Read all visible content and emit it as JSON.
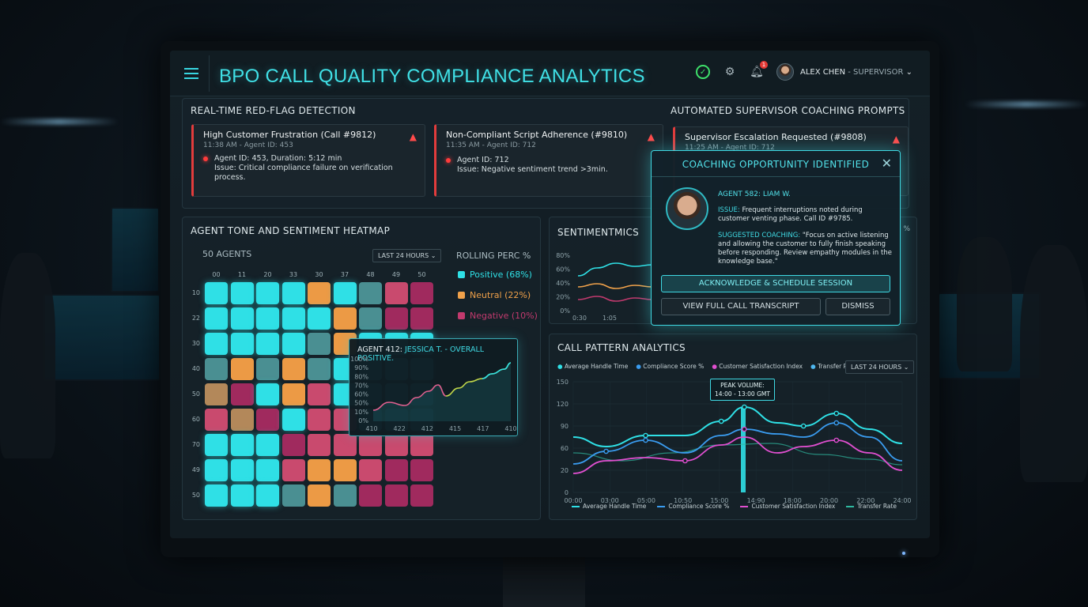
{
  "header": {
    "title": "BPO CALL QUALITY COMPLIANCE ANALYTICS",
    "notification_count": "1",
    "user_name": "ALEX CHEN",
    "user_role": " - SUPERVISOR"
  },
  "red_flags": {
    "title": "REAL-TIME RED-FLAG DETECTION",
    "alerts": [
      {
        "title": "High Customer Frustration (Call #9812)",
        "time": "11:38 AM - Agent ID: 453",
        "line1": "Agent ID: 453, Duration: 5:12 min",
        "line2": "Issue: Critical compliance failure on verification process."
      },
      {
        "title": "Non-Compliant Script Adherence (#9810)",
        "time": "11:35 AM - Agent ID: 712",
        "line1": "Agent ID: 712",
        "line2": "Issue: Negative sentiment trend >3min."
      }
    ]
  },
  "coaching": {
    "title": "AUTOMATED SUPERVISOR COACHING PROMPTS",
    "alert": {
      "title": "Supervisor Escalation Requested (#9808)",
      "time": "11:25 AM - Agent ID: 712"
    },
    "modal": {
      "title": "COACHING OPPORTUNITY IDENTIFIED",
      "agent": "AGENT 582: LIAM W.",
      "issue_label": "ISSUE:",
      "issue": "Frequent interruptions noted during customer venting phase. Call ID #9785.",
      "suggest_label": "SUGGESTED COACHING:",
      "suggest": "\"Focus on active listening and allowing the customer to fully finish speaking before responding. Review empathy modules in the knowledge base.\"",
      "btn_ack": "ACKNOWLEDGE & SCHEDULE SESSION",
      "btn_transcript": "VIEW FULL CALL TRANSCRIPT",
      "btn_dismiss": "DISMISS"
    }
  },
  "heatmap": {
    "title": "AGENT TONE AND SENTIMENT HEATMAP",
    "agents": "50 AGENTS",
    "range": "LAST 24 HOURS",
    "rolling_title": "ROLLING PERC %",
    "legend": [
      {
        "label": "Positive (68%)",
        "color": "#2fe0e6"
      },
      {
        "label": "Neutral (22%)",
        "color": "#f0a14a"
      },
      {
        "label": "Negative (10%)",
        "color": "#c23a6e"
      }
    ],
    "col_labels": [
      "00",
      "11",
      "20",
      "33",
      "30",
      "37",
      "48",
      "49",
      "50"
    ],
    "row_labels": [
      "10",
      "22",
      "30",
      "40",
      "50",
      "60",
      "70",
      "49",
      "50"
    ],
    "grid": [
      [
        "P",
        "P",
        "P",
        "P",
        "N",
        "P",
        "M",
        "R",
        "X"
      ],
      [
        "P",
        "P",
        "P",
        "P",
        "P",
        "N",
        "M",
        "X",
        "X"
      ],
      [
        "P",
        "P",
        "P",
        "P",
        "M",
        "N",
        "P",
        "P",
        "P"
      ],
      [
        "M",
        "N",
        "M",
        "N",
        "M",
        "P",
        "P",
        "P",
        "P"
      ],
      [
        "O",
        "X",
        "P",
        "N",
        "R",
        "P",
        "P",
        "P",
        "P"
      ],
      [
        "R",
        "O",
        "X",
        "P",
        "R",
        "R",
        "P",
        "P",
        "P"
      ],
      [
        "P",
        "P",
        "P",
        "X",
        "R",
        "R",
        "R",
        "R",
        "R"
      ],
      [
        "P",
        "P",
        "P",
        "R",
        "N",
        "N",
        "R",
        "X",
        "X"
      ],
      [
        "P",
        "P",
        "P",
        "M",
        "N",
        "M",
        "X",
        "X",
        "X"
      ]
    ],
    "colors": {
      "P": "#2fe0e6",
      "M": "#4a8f92",
      "N": "#ec9a45",
      "O": "#b3885a",
      "R": "#c94a6e",
      "X": "#a02a5e"
    },
    "tooltip": {
      "agent": "AGENT 412:",
      "rest": " JESSICA T. - OVERALL POSITIVE.",
      "y_ticks": [
        "100%",
        "90%",
        "80%",
        "70%",
        "60%",
        "50%",
        "10%",
        "0%"
      ],
      "x_ticks": [
        "410",
        "422",
        "412",
        "415",
        "417",
        "410"
      ]
    }
  },
  "sentiment": {
    "title": "SENTIMENT",
    "title_tail": "MICS",
    "y_ticks": [
      "80%",
      "60%",
      "40%",
      "20%",
      "0%"
    ],
    "x_ticks": [
      "0:30",
      "1:05"
    ],
    "side_label": "%"
  },
  "call_pattern": {
    "title": "CALL PATTERN ANALYTICS",
    "range": "LAST 24 HOURS",
    "peak_title": "PEAK VOLUME:",
    "peak_time": "14:00 - 13:00 GMT",
    "legend_top": [
      {
        "label": "Average Handle Time",
        "color": "#2fe0e6"
      },
      {
        "label": "Compliance Score %",
        "color": "#3a9cf0"
      },
      {
        "label": "Customer Satisfaction Index",
        "color": "#e04fd0"
      },
      {
        "label": "Transfer Rate",
        "color": "#4fb8f0"
      }
    ],
    "legend_bottom": [
      {
        "label": "Average Handle Time",
        "color": "#2fe0e6"
      },
      {
        "label": "Compliance Score %",
        "color": "#3a9cf0"
      },
      {
        "label": "Customer Satisfaction Index",
        "color": "#e04fd0"
      },
      {
        "label": "Transfer Rate",
        "color": "#2fb9a0"
      }
    ],
    "y_ticks": [
      "150",
      "120",
      "90",
      "60",
      "20",
      "0"
    ],
    "x_ticks": [
      "00:00",
      "03:00",
      "05:00",
      "10:50",
      "15:00",
      "14:90",
      "18:00",
      "20:00",
      "22:00",
      "24:00"
    ]
  }
}
